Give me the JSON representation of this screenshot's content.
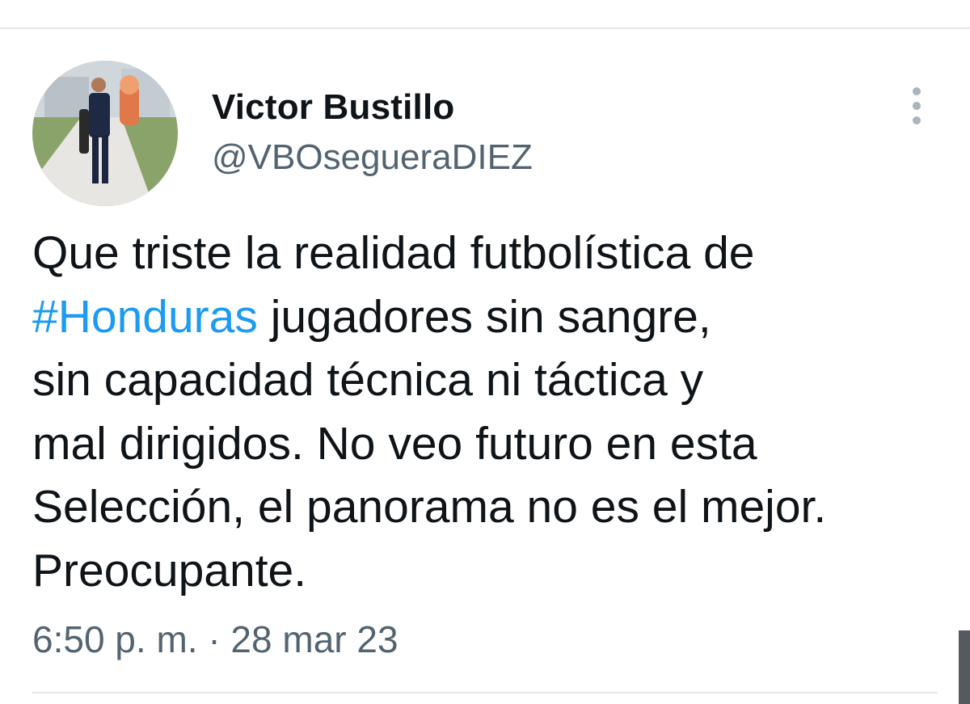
{
  "author": {
    "display_name": "Victor Bustillo",
    "handle": "@VBOsegueraDIEZ"
  },
  "tweet": {
    "lines": [
      {
        "text": "Que triste la realidad futbolística de"
      },
      {
        "hashtag": "#Honduras",
        "rest": " jugadores sin sangre,"
      },
      {
        "text": "sin capacidad técnica ni táctica y"
      },
      {
        "text": "mal dirigidos. No veo futuro en esta"
      },
      {
        "text": "Selección, el panorama no es el mejor."
      },
      {
        "text": "Preocupante."
      }
    ]
  },
  "timestamp": "6:50 p. m. · 28 mar 23",
  "icons": {
    "more": "more-vertical-icon"
  },
  "colors": {
    "text": "#0f1419",
    "secondary": "#536471",
    "hashtag": "#1d9bf0"
  }
}
